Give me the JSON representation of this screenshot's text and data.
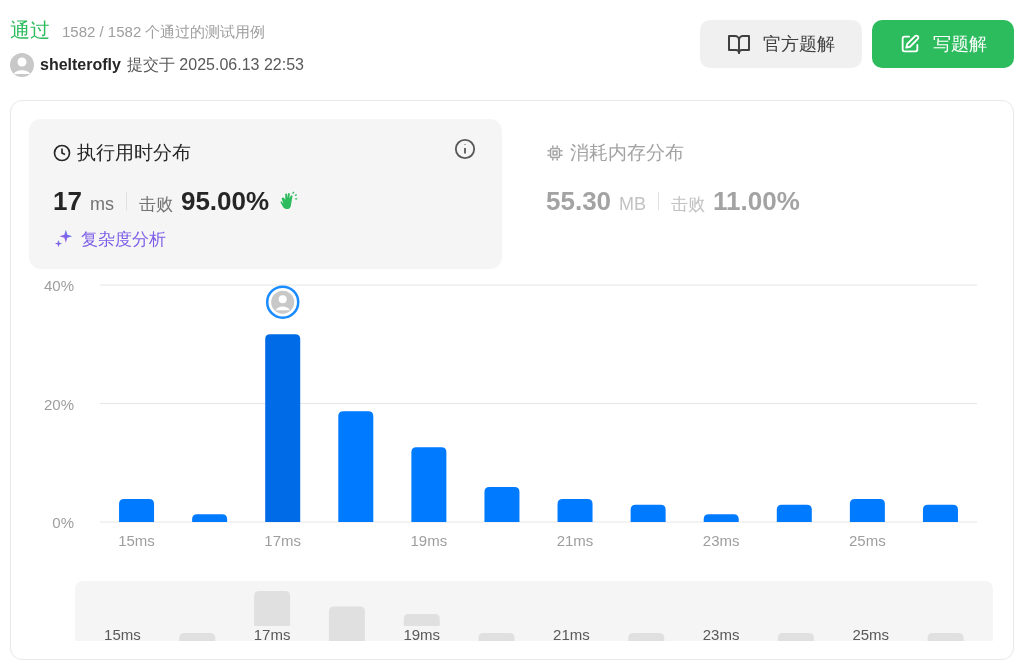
{
  "result": {
    "status": "通过",
    "summary": "1582 / 1582 个通过的测试用例",
    "user": "shelterofly",
    "submitted": "提交于 2025.06.13 22:53"
  },
  "buttons": [
    {
      "kind": "secondary",
      "label": "官方题解"
    },
    {
      "kind": "primary",
      "label": "写题解"
    }
  ],
  "stats": [
    {
      "title": "执行用时分布",
      "selected": true,
      "value": "17",
      "unit": "ms",
      "beats_label": "击败",
      "beats": "95.00%",
      "link": "复杂度分析"
    },
    {
      "title": "消耗内存分布",
      "selected": false,
      "value": "55.30",
      "unit": "MB",
      "beats_label": "击败",
      "beats": "11.00%"
    }
  ],
  "chart": {
    "chart_data": {
      "type": "bar",
      "x": [
        15,
        16,
        17,
        18,
        19,
        20,
        21,
        22,
        23,
        24,
        25,
        26
      ],
      "values": [
        3.9,
        1.3,
        31.7,
        18.7,
        12.6,
        5.9,
        3.9,
        2.9,
        1.3,
        2.9,
        3.9,
        2.9
      ],
      "xlim": [
        14.5,
        26.5
      ],
      "ylim": [
        0,
        40
      ],
      "yticks": [
        {
          "value": 0,
          "label": "0%"
        },
        {
          "value": 20,
          "label": "20%"
        },
        {
          "value": 40,
          "label": "40%"
        }
      ],
      "xticks": [
        {
          "value": 15,
          "label": "15ms"
        },
        {
          "value": 17,
          "label": "17ms"
        },
        {
          "value": 19,
          "label": "19ms"
        },
        {
          "value": 21,
          "label": "21ms"
        },
        {
          "value": 23,
          "label": "23ms"
        },
        {
          "value": 25,
          "label": "25ms"
        }
      ]
    }
  },
  "overview": {
    "labels": [
      "15ms",
      "17ms",
      "19ms",
      "21ms",
      "23ms",
      "25ms"
    ]
  }
}
